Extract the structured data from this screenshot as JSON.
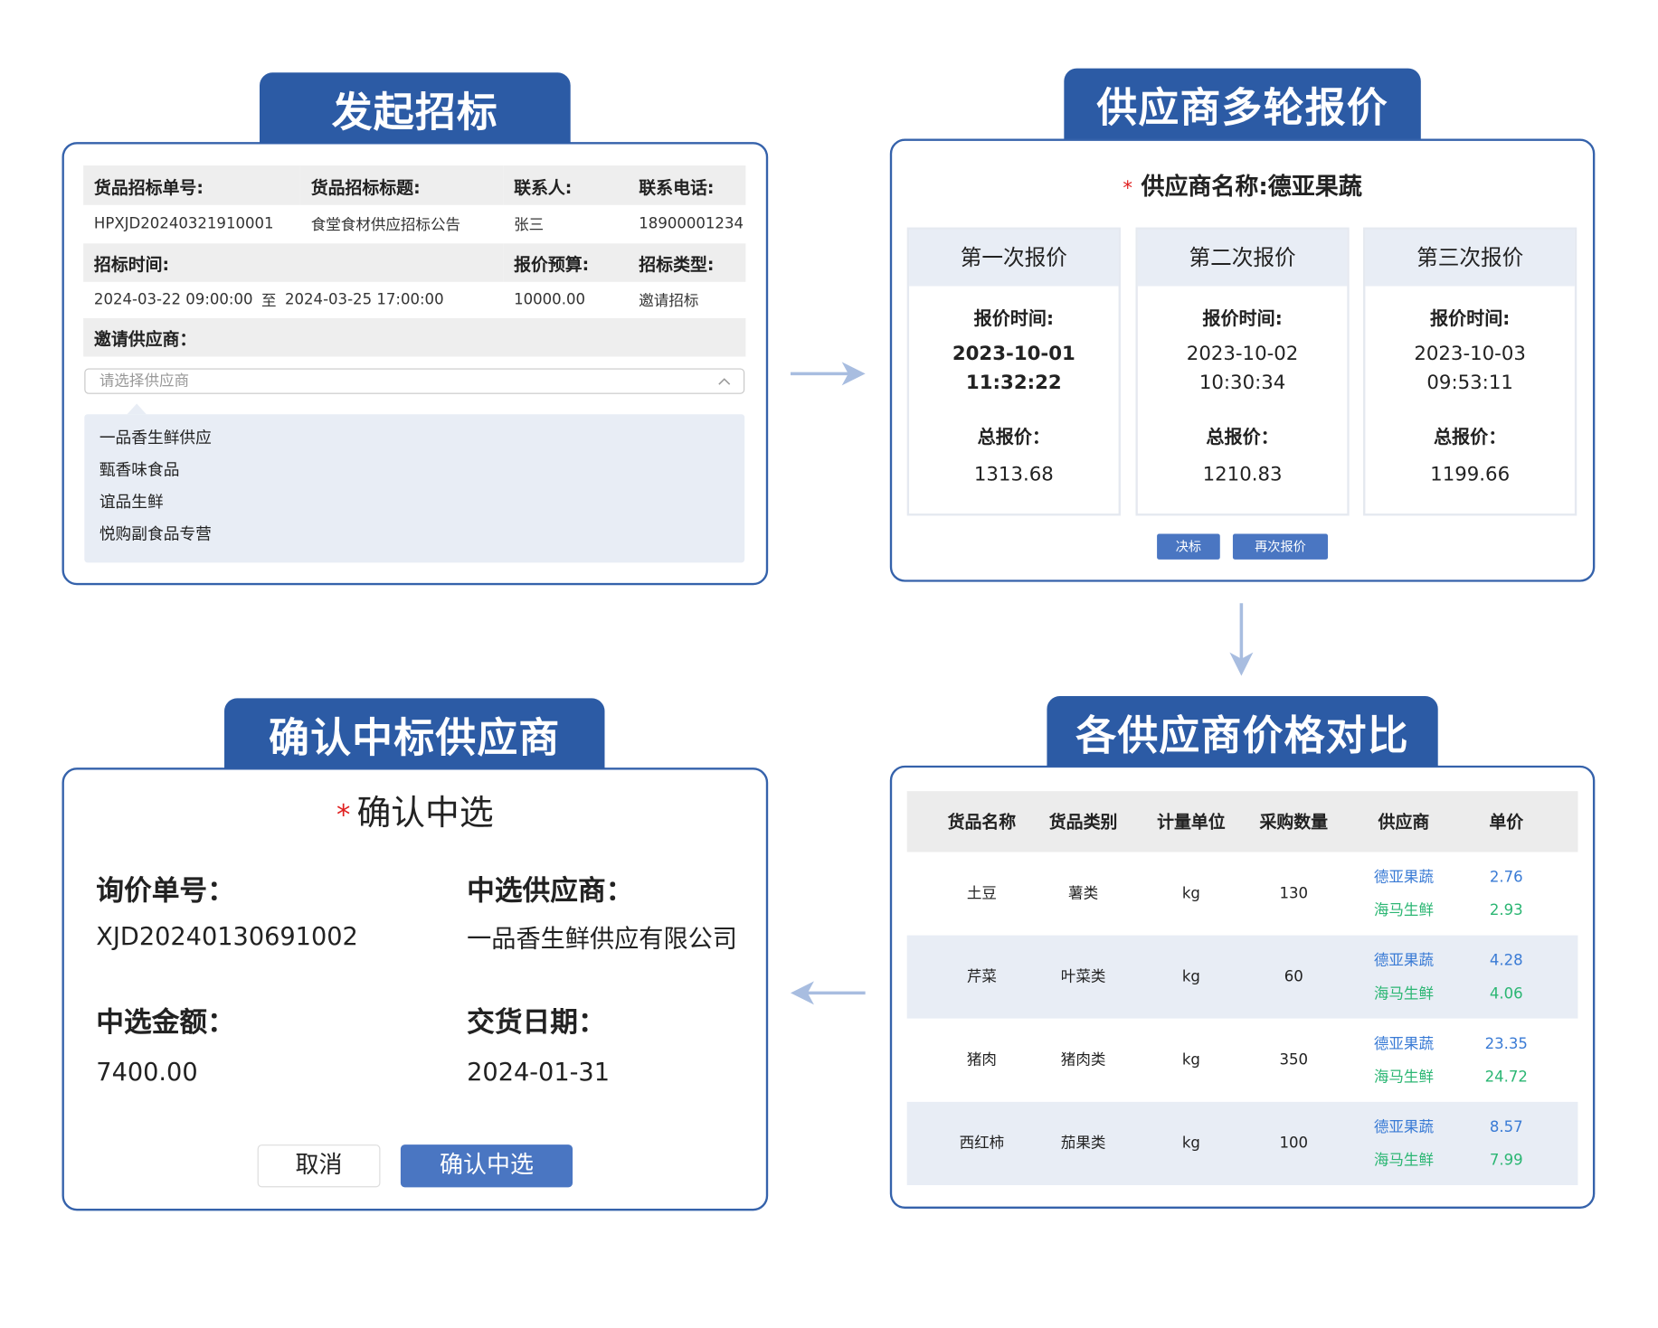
{
  "colors": {
    "primary": "#2c5ba5",
    "border": "#3562ab",
    "button": "#4a76c2",
    "supplier_a": "#3a7bd5",
    "supplier_b": "#2bb673",
    "required": "#e02020",
    "arrow": "#a8bde0"
  },
  "initiate": {
    "title": "发起招标",
    "labels": {
      "no": "货品招标单号:",
      "subject": "货品招标标题:",
      "contact": "联系人:",
      "phone": "联系电话:",
      "time": "招标时间:",
      "budget": "报价预算:",
      "type": "招标类型:",
      "invite": "邀请供应商："
    },
    "values": {
      "no": "HPXJD20240321910001",
      "subject": "食堂食材供应招标公告",
      "contact": "张三",
      "phone": "18900001234",
      "start": "2024-03-22 09:00:00",
      "to": "至",
      "end": "2024-03-25 17:00:00",
      "budget": "10000.00",
      "type": "邀请招标"
    },
    "supplier_select": {
      "placeholder": "请选择供应商",
      "options": [
        "一品香生鲜供应",
        "甄香味食品",
        "谊品生鲜",
        "悦购副食品专营"
      ]
    }
  },
  "quotes": {
    "title": "供应商多轮报价",
    "required_mark": "*",
    "supplier_label": "供应商名称:",
    "supplier_name": "德亚果蔬",
    "rounds": [
      {
        "title": "第一次报价",
        "time_label": "报价时间:",
        "date": "2023-10-01",
        "time": "11:32:22",
        "total_label": "总报价：",
        "total": "1313.68"
      },
      {
        "title": "第二次报价",
        "time_label": "报价时间:",
        "date": "2023-10-02",
        "time": "10:30:34",
        "total_label": "总报价：",
        "total": "1210.83"
      },
      {
        "title": "第三次报价",
        "time_label": "报价时间:",
        "date": "2023-10-03",
        "time": "09:53:11",
        "total_label": "总报价：",
        "total": "1199.66"
      }
    ],
    "buttons": {
      "award": "决标",
      "requote": "再次报价"
    }
  },
  "confirm": {
    "title": "确认中标供应商",
    "required_mark": "*",
    "heading": "确认中选",
    "fields": [
      {
        "label": "询价单号：",
        "value": "XJD20240130691002"
      },
      {
        "label": "中选供应商：",
        "value": "一品香生鲜供应有限公司"
      },
      {
        "label": "中选金额：",
        "value": "7400.00"
      },
      {
        "label": "交货日期：",
        "value": "2024-01-31"
      }
    ],
    "buttons": {
      "cancel": "取消",
      "confirm": "确认中选"
    }
  },
  "compare": {
    "title": "各供应商价格对比",
    "columns": [
      "货品名称",
      "货品类别",
      "计量单位",
      "采购数量",
      "供应商",
      "单价"
    ],
    "rows": [
      {
        "name": "土豆",
        "category": "薯类",
        "unit": "kg",
        "quantity": "130",
        "offers": [
          {
            "supplier": "德亚果蔬",
            "price": "2.76"
          },
          {
            "supplier": "海马生鲜",
            "price": "2.93"
          }
        ]
      },
      {
        "name": "芹菜",
        "category": "叶菜类",
        "unit": "kg",
        "quantity": "60",
        "offers": [
          {
            "supplier": "德亚果蔬",
            "price": "4.28"
          },
          {
            "supplier": "海马生鲜",
            "price": "4.06"
          }
        ]
      },
      {
        "name": "猪肉",
        "category": "猪肉类",
        "unit": "kg",
        "quantity": "350",
        "offers": [
          {
            "supplier": "德亚果蔬",
            "price": "23.35"
          },
          {
            "supplier": "海马生鲜",
            "price": "24.72"
          }
        ]
      },
      {
        "name": "西红柿",
        "category": "茄果类",
        "unit": "kg",
        "quantity": "100",
        "offers": [
          {
            "supplier": "德亚果蔬",
            "price": "8.57"
          },
          {
            "supplier": "海马生鲜",
            "price": "7.99"
          }
        ]
      }
    ]
  }
}
